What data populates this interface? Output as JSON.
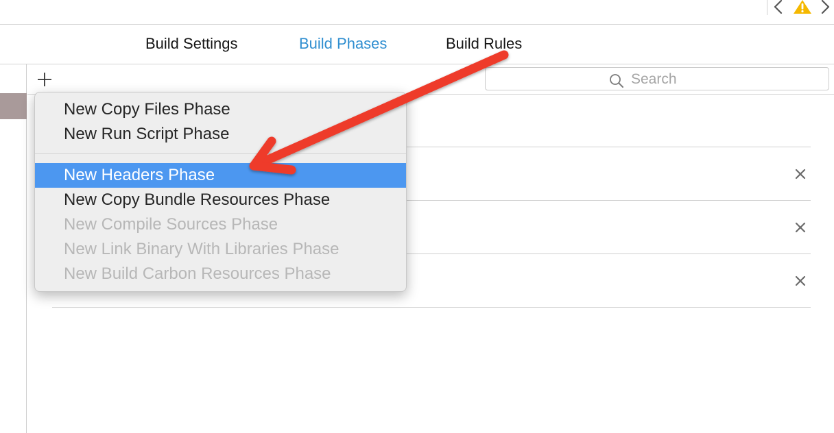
{
  "toolbar": {
    "back_icon": "chevron-left-icon",
    "warning_icon": "warning-icon",
    "forward_icon": "chevron-right-icon",
    "warning_color": "#f5b800"
  },
  "tabs": [
    {
      "label": "Build Settings",
      "active": false
    },
    {
      "label": "Build Phases",
      "active": true
    },
    {
      "label": "Build Rules",
      "active": false
    }
  ],
  "accent_color": "#2f8ed0",
  "filter_bar": {
    "add_icon": "plus-icon",
    "search": {
      "placeholder": "Search",
      "value": "",
      "icon": "search-icon"
    }
  },
  "phase_rows": [
    {
      "remove_icon": "close-icon"
    },
    {
      "remove_icon": "close-icon"
    },
    {
      "remove_icon": "close-icon"
    }
  ],
  "menu": {
    "group1": [
      {
        "label": "New Copy Files Phase",
        "enabled": true
      },
      {
        "label": "New Run Script Phase",
        "enabled": true
      }
    ],
    "group2": [
      {
        "label": "New Headers Phase",
        "enabled": true,
        "highlighted": true
      },
      {
        "label": "New Copy Bundle Resources Phase",
        "enabled": true
      },
      {
        "label": "New Compile Sources Phase",
        "enabled": false
      },
      {
        "label": "New Link Binary With Libraries Phase",
        "enabled": false
      },
      {
        "label": "New Build Carbon Resources Phase",
        "enabled": false
      }
    ],
    "highlight_color": "#4c97f0"
  },
  "annotation": {
    "type": "arrow",
    "color": "#ee3a2c",
    "points_to": "New Headers Phase"
  }
}
